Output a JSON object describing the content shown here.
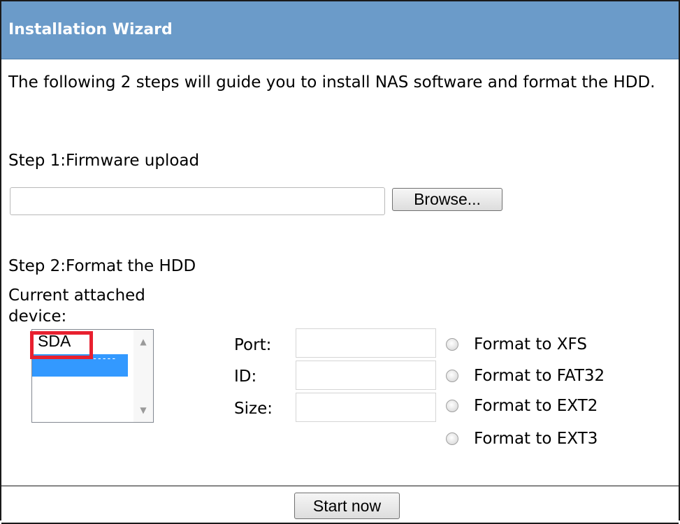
{
  "window": {
    "title": "Installation Wizard"
  },
  "intro": {
    "text": "The following 2 steps will guide you to install NAS software and format the HDD."
  },
  "step1": {
    "label": "Step 1:Firmware upload",
    "file_value": "",
    "browse_label": "Browse..."
  },
  "step2": {
    "label": "Step 2:Format the HDD",
    "current_device_label": "Current attached device:",
    "devices": [
      "SDA",
      "---------------"
    ],
    "selected_device_index": 1,
    "highlight_color": "#e8202f",
    "selection_color": "#3399ff",
    "fields": {
      "port_label": "Port:",
      "port_value": "",
      "id_label": "ID:",
      "id_value": "",
      "size_label": "Size:",
      "size_value": ""
    },
    "format_options": [
      "Format to XFS",
      "Format to FAT32",
      "Format to EXT2",
      "Format to EXT3"
    ],
    "selected_format": null
  },
  "footer": {
    "start_label": "Start now"
  },
  "theme": {
    "title_bar_color": "#6b9bc9",
    "title_text_color": "#ffffff"
  }
}
